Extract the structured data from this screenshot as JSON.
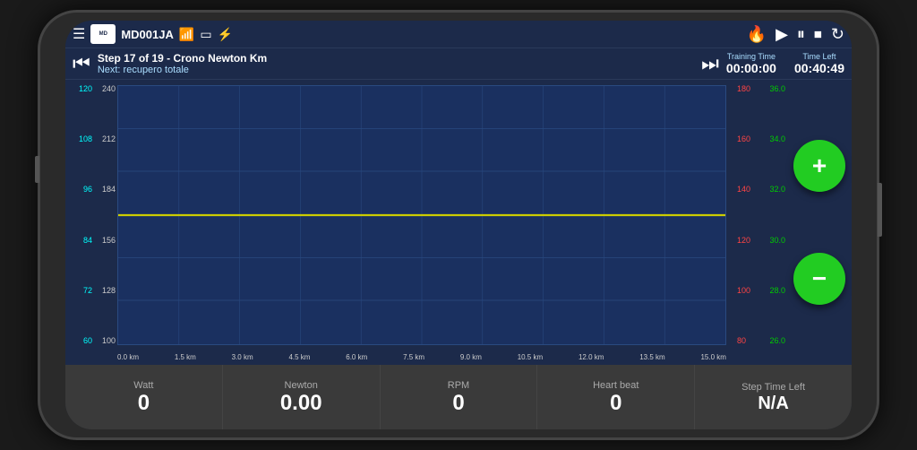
{
  "header": {
    "hamburger": "☰",
    "logo_text": "MD",
    "device_id": "MD001JA",
    "wifi_icon": "📶",
    "battery_icon": "🔋",
    "bolt_icon": "⚡"
  },
  "controls": {
    "flame": "🔥",
    "play": "▶",
    "pause": "⏸",
    "stop": "⏹",
    "refresh": "↻"
  },
  "step": {
    "title": "Step 17 of 19 - Crono Newton Km",
    "next_label": "Next: recupero totale",
    "training_time_label": "Training Time",
    "training_time_value": "00:00:00",
    "time_left_label": "Time Left",
    "time_left_value": "00:40:49"
  },
  "chart": {
    "y_left_cyan": [
      "120",
      "108",
      "96",
      "84",
      "72",
      "60"
    ],
    "y_left_white": [
      "240",
      "212",
      "184",
      "156",
      "128",
      "100"
    ],
    "y_right_red": [
      "180",
      "160",
      "140",
      "120",
      "100",
      "80"
    ],
    "y_right_green": [
      "36.0",
      "34.0",
      "32.0",
      "30.0",
      "28.0",
      "26.0"
    ],
    "x_labels": [
      "0.0 km",
      "1.5 km",
      "3.0 km",
      "4.5 km",
      "6.0 km",
      "7.5 km",
      "9.0 km",
      "10.5 km",
      "12.0 km",
      "13.5 km",
      "15.0 km"
    ]
  },
  "buttons": {
    "plus": "+",
    "minus": "−"
  },
  "metrics": [
    {
      "label": "Watt",
      "value": "0"
    },
    {
      "label": "Newton",
      "value": "0.00"
    },
    {
      "label": "RPM",
      "value": "0"
    },
    {
      "label": "Heart beat",
      "value": "0"
    },
    {
      "label": "Step Time Left",
      "value": "N/A"
    }
  ]
}
